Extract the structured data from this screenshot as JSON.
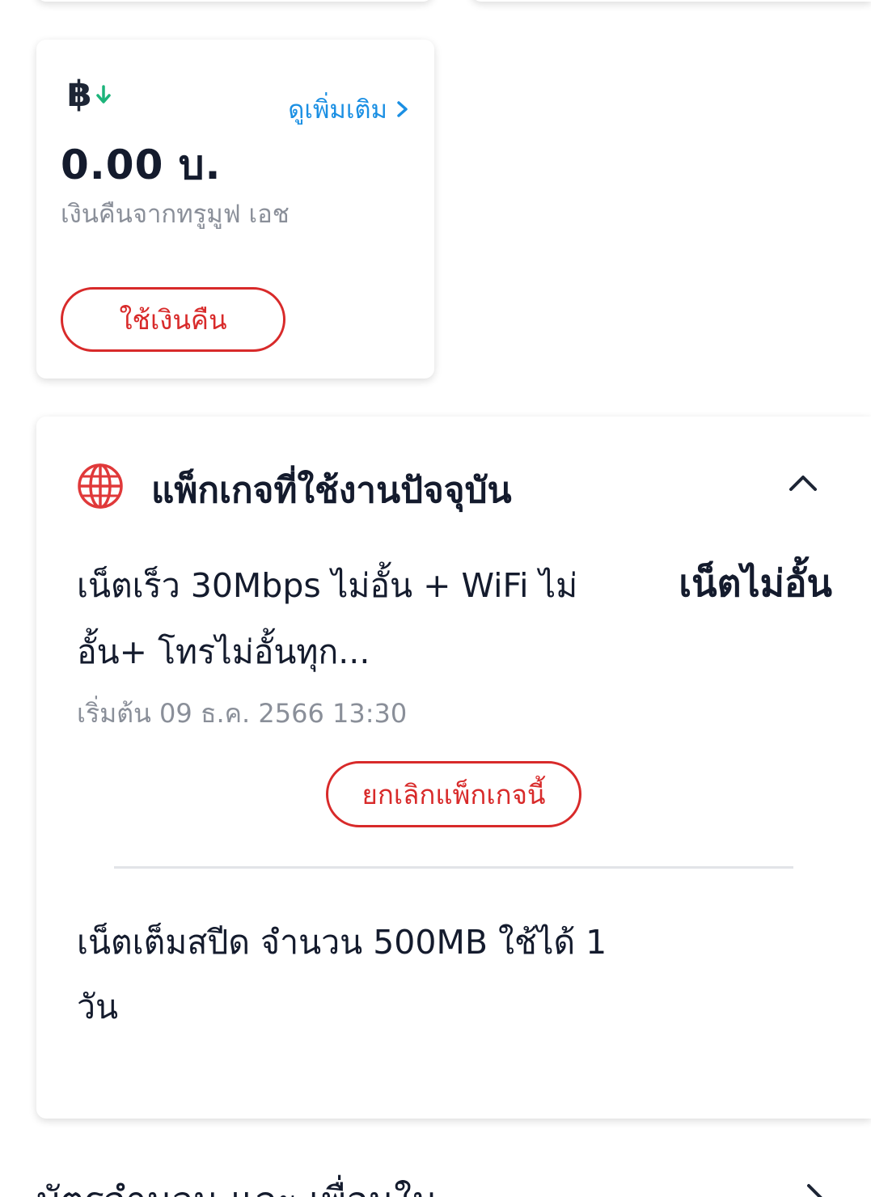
{
  "cashback": {
    "see_more_label": "ดูเพิ่มเติม",
    "amount": "0.00 บ.",
    "caption": "เงินคืนจากทรูมูฟ เอช",
    "use_button_label": "ใช้เงินคืน",
    "icon": "baht-down-icon",
    "link_color": "#1a8fe3"
  },
  "package": {
    "title": "แพ็กเกจที่ใช้งานปัจจุบัน",
    "icon": "globe-icon",
    "plan_name": "เน็ตเร็ว 30Mbps ไม่อั้น + WiFi ไม่อั้น+ โทรไม่อั้นทุก...",
    "plan_tag": "เน็ตไม่อั้น",
    "start_text": "เริ่มต้น 09 ธ.ค. 2566 13:30",
    "cancel_button_label": "ยกเลิกแพ็กเกจนี้",
    "addon_name": "เน็ตเต็มสปีด จำนวน 500MB ใช้ได้ 1 วัน",
    "accent_color": "#d82a2a"
  },
  "next_row": {
    "label": "บัตรจำนวน และ เพื่อนใน"
  }
}
